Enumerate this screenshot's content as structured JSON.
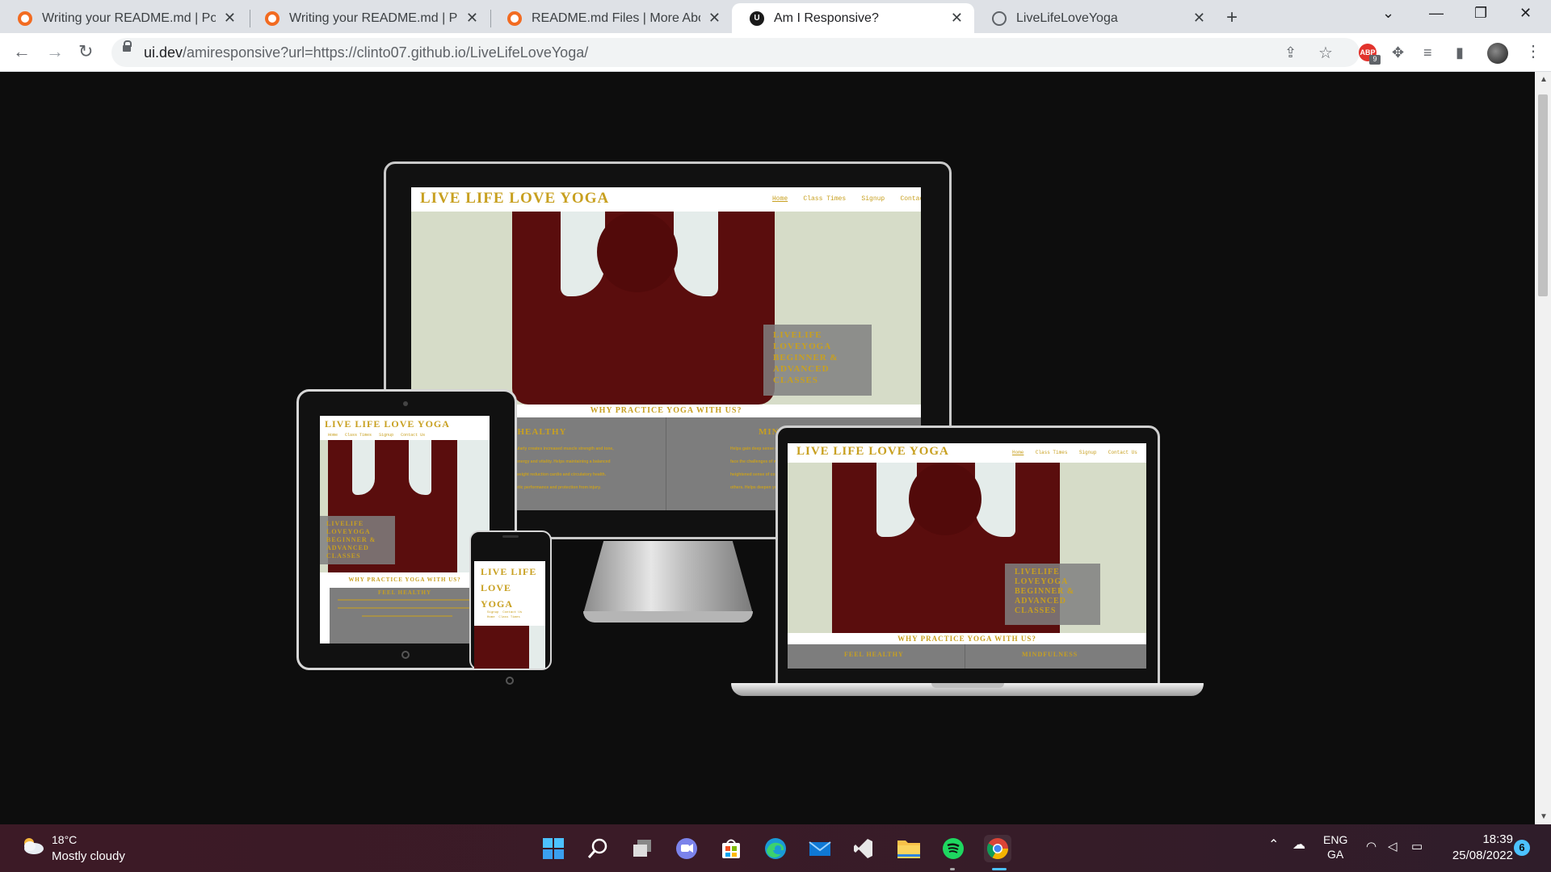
{
  "browser": {
    "tabs": [
      {
        "title": "Writing your README.md | Portfo",
        "icon": "orange-ring-icon",
        "active": false
      },
      {
        "title": "Writing your README.md | Portfo",
        "icon": "orange-ring-icon",
        "active": false
      },
      {
        "title": "README.md Files | More About C",
        "icon": "orange-ring-icon",
        "active": false
      },
      {
        "title": "Am I Responsive?",
        "icon": "ui-dev-icon",
        "active": true
      },
      {
        "title": "LiveLifeLoveYoga",
        "icon": "globe-icon",
        "active": false
      }
    ],
    "url_host": "ui.dev",
    "url_path": "/amiresponsive?url=https://clinto07.github.io/LiveLifeLoveYoga/",
    "extension_badge": "9",
    "extension_label": "ABP"
  },
  "site": {
    "brand": "LIVE LIFE LOVE YOGA",
    "brand_phone_lines": [
      "LIVE LIFE",
      "LOVE",
      "YOGA"
    ],
    "nav": [
      "Home",
      "Class Times",
      "Signup",
      "Contact Us"
    ],
    "nav_phone": [
      "Signup",
      "Contact Us",
      "Home",
      "Class Times"
    ],
    "promo_lines": [
      "LIVELIFE",
      "LOVEYOGA",
      "BEGINNER &",
      "ADVANCED",
      "CLASSES"
    ],
    "why_heading": "WHY PRACTICE YOGA WITH US?",
    "cards": [
      {
        "title": "FEEL HEALTHY",
        "desktop_fragment": "L HEALTHY"
      },
      {
        "title": "MINDFULNESS",
        "desktop_fragment": "MIN"
      }
    ],
    "desktop_card_text": [
      "ularly creates increased muscle strength and tone,",
      "energy and vitality. Helps maintaining a balanced",
      "weight reduction cardio and circulatory health.",
      "etic performance and protection from injury."
    ],
    "desktop_card_text_right": [
      "Helps gain deep sense of",
      "face the challenges of we",
      "heightened sense of co",
      "others. Helps deepen yo"
    ]
  },
  "taskbar": {
    "temperature": "18°C",
    "condition": "Mostly cloudy",
    "apps": [
      "start-icon",
      "search-icon",
      "task-view-icon",
      "teams-chat-icon",
      "store-icon",
      "edge-icon",
      "mail-icon",
      "vscode-icon",
      "file-explorer-icon",
      "spotify-icon",
      "chrome-icon"
    ],
    "lang": "ENG",
    "layout": "GA",
    "time": "18:39",
    "date": "25/08/2022",
    "notification_count": "6"
  }
}
